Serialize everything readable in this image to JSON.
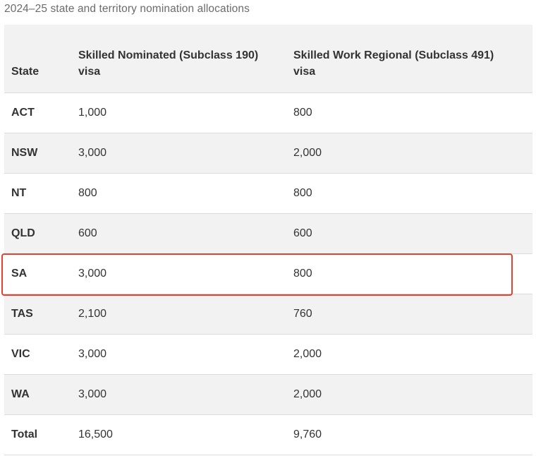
{
  "caption": "2024–25 state and territory nomination allocations",
  "colors": {
    "highlight_border": "#e0432f",
    "alt_row": "#f2f2f2",
    "divider": "#dcdcdc"
  },
  "table": {
    "headers": [
      "State",
      "Skilled Nominated (Subclass 190) visa",
      "Skilled Work Regional (Subclass 491) visa"
    ],
    "rows": [
      {
        "state": "ACT",
        "subclass_190": "1,000",
        "subclass_491": "800"
      },
      {
        "state": "NSW",
        "subclass_190": "3,000",
        "subclass_491": "2,000"
      },
      {
        "state": "NT",
        "subclass_190": "800",
        "subclass_491": "800"
      },
      {
        "state": "QLD",
        "subclass_190": "600",
        "subclass_491": "600"
      },
      {
        "state": "SA",
        "subclass_190": "3,000",
        "subclass_491": "800"
      },
      {
        "state": "TAS",
        "subclass_190": "2,100",
        "subclass_491": "760"
      },
      {
        "state": "VIC",
        "subclass_190": "3,000",
        "subclass_491": "2,000"
      },
      {
        "state": "WA",
        "subclass_190": "3,000",
        "subclass_491": "2,000"
      },
      {
        "state": "Total",
        "subclass_190": "16,500",
        "subclass_491": "9,760"
      }
    ],
    "highlighted_row": "SA"
  }
}
